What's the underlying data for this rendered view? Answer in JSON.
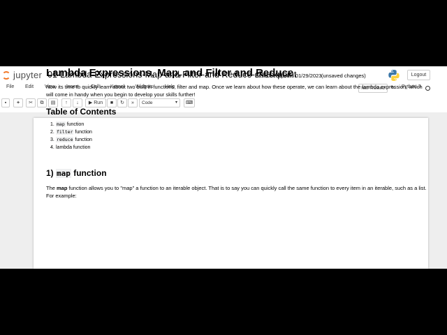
{
  "header": {
    "logo_text": "jupyter",
    "notebook_title": "01-Lambda-Expressions-Map-and-Filter-and Reduce-checkpoint",
    "checkpoint": "Last Checkpoint: 01/29/2023",
    "save_status": "(unsaved changes)",
    "logout_label": "Logout"
  },
  "menubar": {
    "items": [
      "File",
      "Edit",
      "View",
      "Insert",
      "Cell",
      "Kernel",
      "Widgets",
      "Help"
    ],
    "trust_label": "Not Trusted",
    "kernel_name": "Python 3"
  },
  "toolbar": {
    "run_label": "Run",
    "cell_type": "Code",
    "icons": [
      "save-icon",
      "add-cell-icon",
      "cut-icon",
      "copy-icon",
      "paste-icon",
      "move-up-icon",
      "move-down-icon",
      "run-icon",
      "stop-icon",
      "restart-icon",
      "fast-forward-icon",
      "keyboard-icon"
    ]
  },
  "notebook": {
    "title": "Lambda Expressions, Map, and Filter and Reduce",
    "intro": "Now its time to quickly learn about two built in functions, filter and map. Once we learn about how these operate, we can learn about the lambda expression, which will come in handy when you begin to develop your skills further!",
    "toc_heading": "Table of Contents",
    "toc": [
      {
        "num": "1.",
        "code": "map",
        "text": " function"
      },
      {
        "num": "2.",
        "code": "filter",
        "text": " function"
      },
      {
        "num": "3.",
        "code": "reduce",
        "text": " function"
      },
      {
        "num": "4.",
        "code": "",
        "text": "lambda function"
      }
    ],
    "section_num": "1) ",
    "section_code": "map",
    "section_text": " function",
    "para_pre": "The ",
    "para_bold": "map",
    "para_post": " function allows you to \"map\" a function to an iterable object. That is to say you can quickly call the same function to every item in an iterable, such as a list. For example:"
  }
}
